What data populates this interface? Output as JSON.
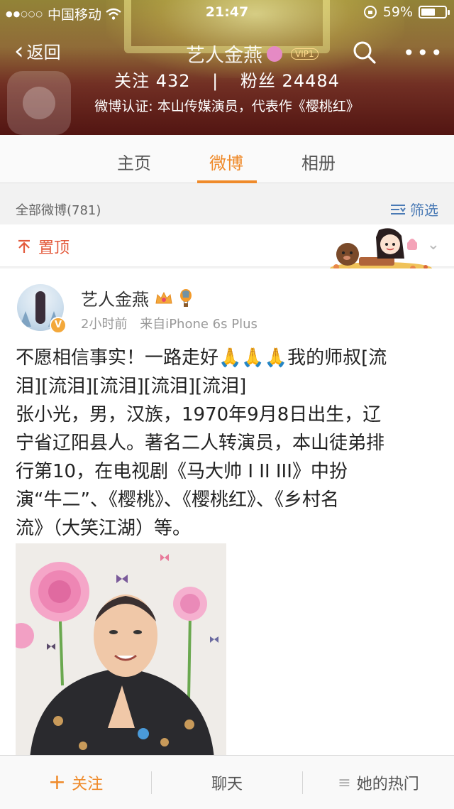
{
  "status_bar": {
    "carrier": "中国移动",
    "time": "21:47",
    "battery": "59%",
    "battery_level": 0.59
  },
  "nav": {
    "back_label": "返回",
    "title": "艺人金燕",
    "vip_label": "VIP1"
  },
  "profile": {
    "following_label": "关注",
    "following_count": "432",
    "followers_label": "粉丝",
    "followers_count": "24484",
    "verification": "微博认证: 本山传媒演员，代表作《樱桃红》"
  },
  "tabs": [
    {
      "label": "主页",
      "active": false
    },
    {
      "label": "微博",
      "active": true
    },
    {
      "label": "相册",
      "active": false
    }
  ],
  "filter": {
    "count_label": "全部微博(781)",
    "filter_label": "筛选"
  },
  "pinned": {
    "label": "置顶"
  },
  "post": {
    "author": "艺人金燕",
    "time": "2小时前",
    "source": "来自iPhone 6s Plus",
    "lines": [
      "不愿相信事实！一路走好🙏🙏🙏我的师叔[流",
      "泪][流泪][流泪][流泪][流泪]",
      "张小光，男，汉族，1970年9月8日出生，辽",
      "宁省辽阳县人。著名二人转演员，本山徒弟排",
      "行第10，在电视剧《马大帅 I II III》中扮",
      "演“牛二”、《樱桃》、《樱桃红》、《乡村名",
      "流》（大笑江湖）等。"
    ]
  },
  "bottom_bar": {
    "follow_label": "关注",
    "chat_label": "聊天",
    "hot_label": "她的热门"
  },
  "colors": {
    "accent": "#ef8a2a",
    "pin_red": "#e35a3c",
    "link_blue": "#4a7ab5"
  }
}
